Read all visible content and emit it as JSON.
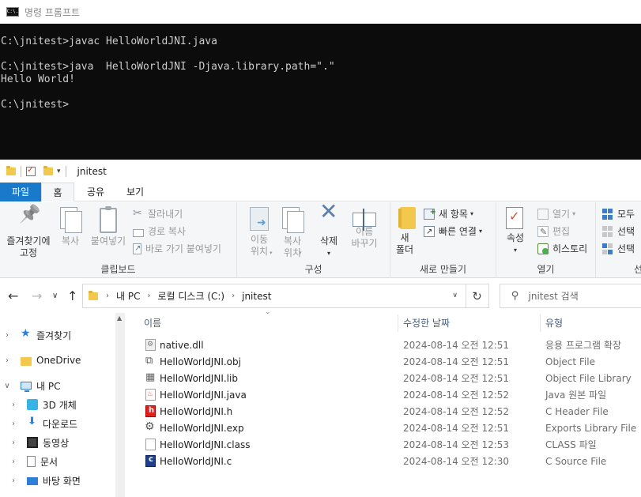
{
  "console": {
    "title": "명령 프롬프트",
    "icon_label": "C:\\.",
    "lines": [
      "C:\\jnitest>javac HelloWorldJNI.java",
      "",
      "C:\\jnitest>java  HelloWorldJNI -Djava.library.path=\".\"",
      "Hello World!",
      "",
      "C:\\jnitest>"
    ]
  },
  "explorer": {
    "quick_access_title": "jnitest",
    "quick_access_arrow": "▾",
    "tabs": {
      "file": "파일",
      "home": "홈",
      "share": "공유",
      "view": "보기"
    },
    "ribbon": {
      "clipboard": {
        "label": "클립보드",
        "pin": "즐겨찾기에\n고정",
        "copy": "복사",
        "paste": "붙여넣기",
        "cut": "잘라내기",
        "copy_path": "경로 복사",
        "paste_shortcut": "바로 가기 붙여넣기"
      },
      "organize": {
        "label": "구성",
        "move_to": "이동\n위치",
        "copy_to": "복사\n위치",
        "delete": "삭제",
        "rename": "이름\n바꾸기"
      },
      "new": {
        "label": "새로 만들기",
        "new_folder": "새\n폴더",
        "new_item": "새 항목",
        "easy_access": "빠른 연결"
      },
      "open": {
        "label": "열기",
        "properties": "속성",
        "open": "열기",
        "edit": "편집",
        "history": "히스토리"
      },
      "select": {
        "label": "선",
        "select_all": "모두",
        "select_none": "선택",
        "invert": "선택"
      }
    },
    "address": {
      "segments": [
        "내 PC",
        "로컬 디스크 (C:)",
        "jnitest"
      ],
      "search_placeholder": "jnitest 검색"
    },
    "nav_pane": {
      "items": [
        {
          "label": "즐겨찾기",
          "icon": "star-icon"
        },
        {
          "label": "OneDrive",
          "icon": "onedrive-folder-icon"
        },
        {
          "label": "내 PC",
          "icon": "pc-icon"
        },
        {
          "label": "3D 개체",
          "icon": "cube-icon"
        },
        {
          "label": "다운로드",
          "icon": "download-icon"
        },
        {
          "label": "동영상",
          "icon": "video-icon"
        },
        {
          "label": "문서",
          "icon": "documents-icon"
        },
        {
          "label": "바탕 화면",
          "icon": "desktop-icon"
        }
      ]
    },
    "columns": {
      "name": "이름",
      "date": "수정한 날짜",
      "type": "유형"
    },
    "files": [
      {
        "name": "native.dll",
        "date": "2024-08-14 오전 12:51",
        "type": "응용 프로그램 확장",
        "icon": "dll-icon"
      },
      {
        "name": "HelloWorldJNI.obj",
        "date": "2024-08-14 오전 12:51",
        "type": "Object File",
        "icon": "obj-icon"
      },
      {
        "name": "HelloWorldJNI.lib",
        "date": "2024-08-14 오전 12:51",
        "type": "Object File Library",
        "icon": "lib-icon"
      },
      {
        "name": "HelloWorldJNI.java",
        "date": "2024-08-14 오전 12:52",
        "type": "Java 원본 파일",
        "icon": "java-icon"
      },
      {
        "name": "HelloWorldJNI.h",
        "date": "2024-08-14 오전 12:52",
        "type": "C Header File",
        "icon": "header-icon"
      },
      {
        "name": "HelloWorldJNI.exp",
        "date": "2024-08-14 오전 12:51",
        "type": "Exports Library File",
        "icon": "exp-icon"
      },
      {
        "name": "HelloWorldJNI.class",
        "date": "2024-08-14 오전 12:53",
        "type": "CLASS 파일",
        "icon": "class-icon"
      },
      {
        "name": "HelloWorldJNI.c",
        "date": "2024-08-14 오전 12:30",
        "type": "C Source File",
        "icon": "c-source-icon"
      }
    ]
  }
}
